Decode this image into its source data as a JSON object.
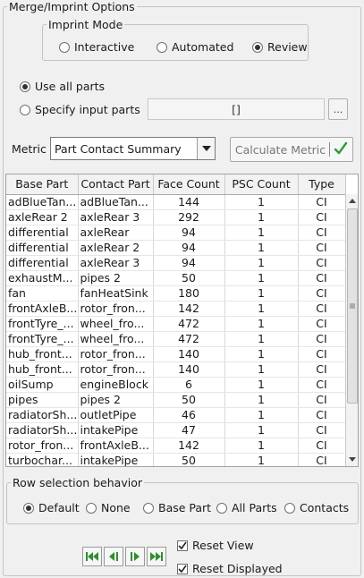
{
  "panel": {
    "title": "Merge/Imprint Options"
  },
  "imprint_mode": {
    "title": "Imprint Mode",
    "options": [
      {
        "label": "Interactive",
        "selected": false
      },
      {
        "label": "Automated",
        "selected": false
      },
      {
        "label": "Review",
        "selected": true
      }
    ]
  },
  "parts": {
    "use_all_label": "Use all parts",
    "use_all_selected": true,
    "specify_label": "Specify input parts",
    "specify_selected": false,
    "input_value": "[]",
    "browse_label": "..."
  },
  "metric": {
    "label": "Metric",
    "selected": "Part Contact Summary",
    "calculate_label": "Calculate Metric"
  },
  "table": {
    "columns": [
      "Base Part",
      "Contact Part",
      "Face Count",
      "PSC Count",
      "Type"
    ],
    "rows": [
      [
        "adBlueTan...",
        "adBlueTan...",
        "144",
        "1",
        "CI"
      ],
      [
        "axleRear 2",
        "axleRear 3",
        "292",
        "1",
        "CI"
      ],
      [
        "differential",
        "axleRear",
        "94",
        "1",
        "CI"
      ],
      [
        "differential",
        "axleRear 2",
        "94",
        "1",
        "CI"
      ],
      [
        "differential",
        "axleRear 3",
        "94",
        "1",
        "CI"
      ],
      [
        "exhaustM...",
        "pipes 2",
        "50",
        "1",
        "CI"
      ],
      [
        "fan",
        "fanHeatSink",
        "180",
        "1",
        "CI"
      ],
      [
        "frontAxleB...",
        "rotor_fron...",
        "142",
        "1",
        "CI"
      ],
      [
        "frontTyre_...",
        "wheel_fro...",
        "472",
        "1",
        "CI"
      ],
      [
        "frontTyre_...",
        "wheel_fro...",
        "472",
        "1",
        "CI"
      ],
      [
        "hub_front...",
        "rotor_fron...",
        "140",
        "1",
        "CI"
      ],
      [
        "hub_front...",
        "rotor_fron...",
        "140",
        "1",
        "CI"
      ],
      [
        "oilSump",
        "engineBlock",
        "6",
        "1",
        "CI"
      ],
      [
        "pipes",
        "pipes 2",
        "50",
        "1",
        "CI"
      ],
      [
        "radiatorSh...",
        "outletPipe",
        "46",
        "1",
        "CI"
      ],
      [
        "radiatorSh...",
        "intakePipe",
        "47",
        "1",
        "CI"
      ],
      [
        "rotor_fron...",
        "frontAxleB...",
        "142",
        "1",
        "CI"
      ],
      [
        "turbochar...",
        "intakePipe",
        "50",
        "1",
        "CI"
      ]
    ]
  },
  "row_selection": {
    "title": "Row selection behavior",
    "options": [
      {
        "label": "Default",
        "selected": true
      },
      {
        "label": "None",
        "selected": false
      },
      {
        "label": "Base Part",
        "selected": false
      },
      {
        "label": "All Parts",
        "selected": false
      },
      {
        "label": "Contacts",
        "selected": false
      }
    ]
  },
  "options": {
    "reset_view_label": "Reset View",
    "reset_view_checked": true,
    "reset_displayed_label": "Reset Displayed",
    "reset_displayed_checked": true
  },
  "icons": {
    "nav": [
      "first-icon",
      "previous-icon",
      "next-icon",
      "last-icon"
    ],
    "calculate": "checkmark-icon",
    "dropdown": "chevron-down-icon"
  },
  "colors": {
    "checkmark": "#2e9b3a",
    "nav_arrow": "#2f8f2f"
  }
}
